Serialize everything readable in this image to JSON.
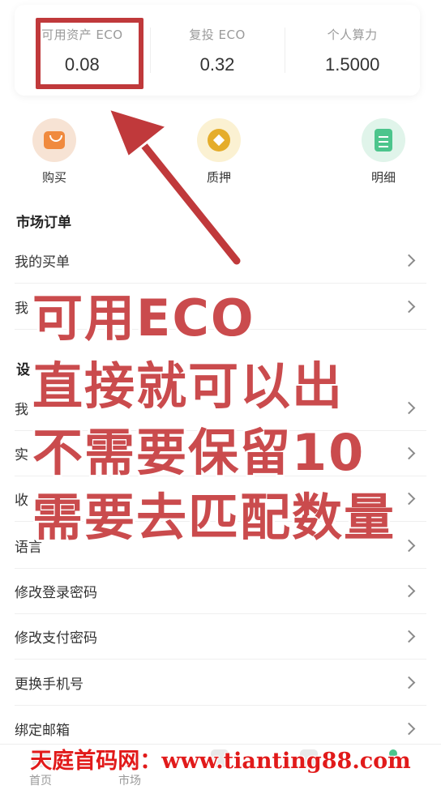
{
  "stats": [
    {
      "label": "可用资产 ECO",
      "value": "0.08"
    },
    {
      "label": "复投 ECO",
      "value": "0.32"
    },
    {
      "label": "个人算力",
      "value": "1.5000"
    }
  ],
  "quick_actions": [
    {
      "label": "购买",
      "icon": "shopping-bag-icon"
    },
    {
      "label": "质押",
      "icon": "coin-icon"
    },
    {
      "label": "明细",
      "icon": "document-icon"
    }
  ],
  "market_section": {
    "title": "市场订单",
    "items": [
      "我的买单",
      "我"
    ]
  },
  "settings_section": {
    "title": "设",
    "items": [
      "我",
      "实",
      "收",
      "语言",
      "修改登录密码",
      "修改支付密码",
      "更换手机号",
      "绑定邮箱"
    ]
  },
  "overlay": {
    "lines": [
      "可用ECO",
      "直接就可以出",
      "不需要保留10",
      "需要去匹配数量"
    ],
    "color": "#ca4b4d"
  },
  "bottom_nav": {
    "items": [
      "首页",
      "市场"
    ]
  },
  "watermark": "天庭首码网：www.tianting88.com",
  "colors": {
    "highlight": "#c0393b",
    "watermark": "#e11a1a"
  }
}
